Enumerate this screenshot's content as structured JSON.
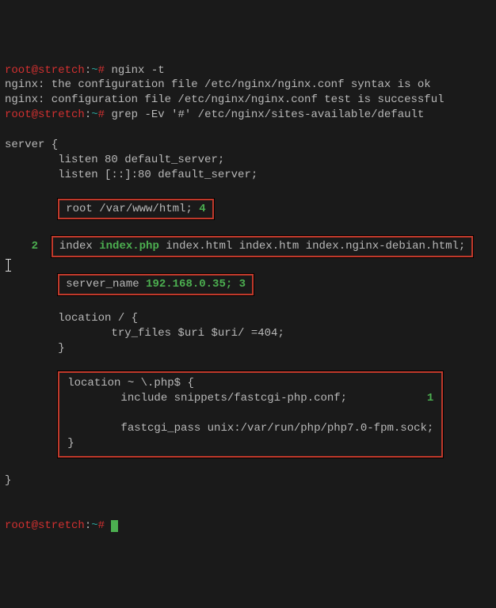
{
  "prompt1": {
    "user": "root@stretch",
    "separator": ":",
    "path": "~",
    "hash": "#"
  },
  "cmd1": "nginx -t",
  "nginx_line1": "nginx: the configuration file /etc/nginx/nginx.conf syntax is ok",
  "nginx_line2": "nginx: configuration file /etc/nginx/nginx.conf test is successful",
  "cmd2": "grep -Ev '#' /etc/nginx/sites-available/default",
  "server_open": "server {",
  "listen1": "        listen 80 default_server;",
  "listen2": "        listen [::]:80 default_server;",
  "box_root": {
    "text": "root /var/www/html;",
    "annot": "4"
  },
  "box_index": {
    "annot": "2",
    "pre": "index ",
    "hl": "index.php",
    "post": " index.html index.htm index.nginx-debian.html;"
  },
  "box_server_name": {
    "pre": "server_name ",
    "hl": "192.168.0.35;",
    "annot": "3"
  },
  "loc_open": "        location / {",
  "loc_try": "                try_files $uri $uri/ =404;",
  "loc_close": "        }",
  "box_php": {
    "l1": "location ~ \\.php$ {",
    "l2": "        include snippets/fastcgi-php.conf;",
    "l3": "        fastcgi_pass unix:/var/run/php/php7.0-fpm.sock;",
    "l4": "}",
    "annot": "1"
  },
  "server_close": "}"
}
